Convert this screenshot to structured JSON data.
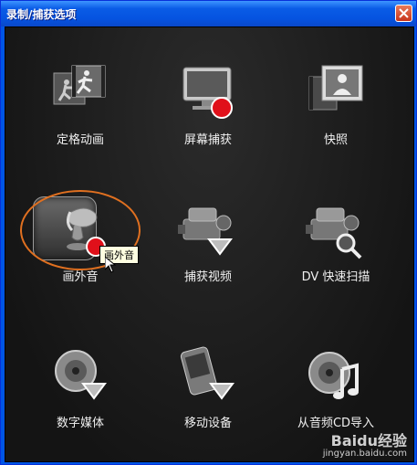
{
  "window": {
    "title": "录制/捕获选项"
  },
  "tiles": [
    {
      "label": "定格动画",
      "icon": "stop-motion-icon"
    },
    {
      "label": "屏幕捕获",
      "icon": "screen-capture-icon"
    },
    {
      "label": "快照",
      "icon": "snapshot-icon"
    },
    {
      "label": "画外音",
      "icon": "voiceover-mic-icon"
    },
    {
      "label": "捕获视频",
      "icon": "capture-video-icon"
    },
    {
      "label": "DV 快速扫描",
      "icon": "dv-quick-scan-icon"
    },
    {
      "label": "数字媒体",
      "icon": "digital-media-icon"
    },
    {
      "label": "移动设备",
      "icon": "mobile-device-icon"
    },
    {
      "label": "从音频CD导入",
      "icon": "import-audio-cd-icon"
    }
  ],
  "tooltip": {
    "text": "画外音"
  },
  "watermark": {
    "brand": "Baidu经验",
    "url": "jingyan.baidu.com"
  },
  "colors": {
    "title_bar": "#0a5ce6",
    "highlight_ring": "#e07020",
    "record_dot": "#e0101a"
  }
}
